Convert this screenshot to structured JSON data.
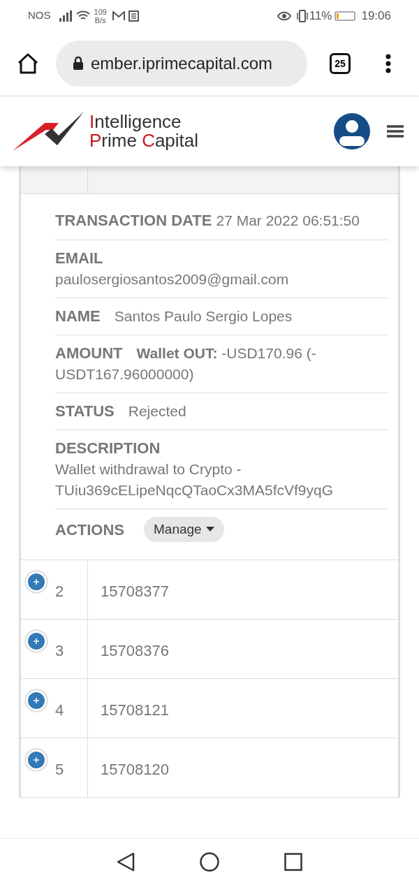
{
  "status_bar": {
    "carrier": "NOS",
    "speed_value": "109",
    "speed_unit": "B/s",
    "battery_text": "11%",
    "time": "19:06"
  },
  "browser": {
    "url": "ember.iprimecapital.com",
    "tab_count": "25"
  },
  "brand": {
    "lines": [
      [
        {
          "text": "I",
          "accent": true
        },
        {
          "text": "ntelligence",
          "accent": false
        }
      ],
      [
        {
          "text": "P",
          "accent": true
        },
        {
          "text": "rime ",
          "accent": false
        },
        {
          "text": "C",
          "accent": true
        },
        {
          "text": "apital",
          "accent": false
        }
      ]
    ]
  },
  "details": [
    {
      "kind": "inline",
      "label": "TRANSACTION DATE",
      "value": "27 Mar 2022 06:51:50"
    },
    {
      "kind": "stacked",
      "label": "EMAIL",
      "value": "paulosergiosantos2009@gmail.com"
    },
    {
      "kind": "aligned",
      "label": "NAME",
      "value": "Santos Paulo Sergio Lopes"
    },
    {
      "kind": "aligned",
      "label": "AMOUNT",
      "value": "**Wallet OUT:** -USD170.96 (-USDT167.96000000)"
    },
    {
      "kind": "aligned",
      "label": "STATUS",
      "value": "Rejected"
    },
    {
      "kind": "stacked",
      "label": "DESCRIPTION",
      "value": "Wallet withdrawal to Crypto - TUiu369cELipeNqcQTaoCx3MA5fcVf9yqG"
    },
    {
      "kind": "action",
      "label": "ACTIONS",
      "value": "Manage"
    }
  ],
  "rows": [
    {
      "index": "2",
      "id": "15708377",
      "expanded": false
    },
    {
      "index": "3",
      "id": "15708376",
      "expanded": false
    },
    {
      "index": "4",
      "id": "15708121",
      "expanded": false
    },
    {
      "index": "5",
      "id": "15708120",
      "expanded": false
    }
  ]
}
